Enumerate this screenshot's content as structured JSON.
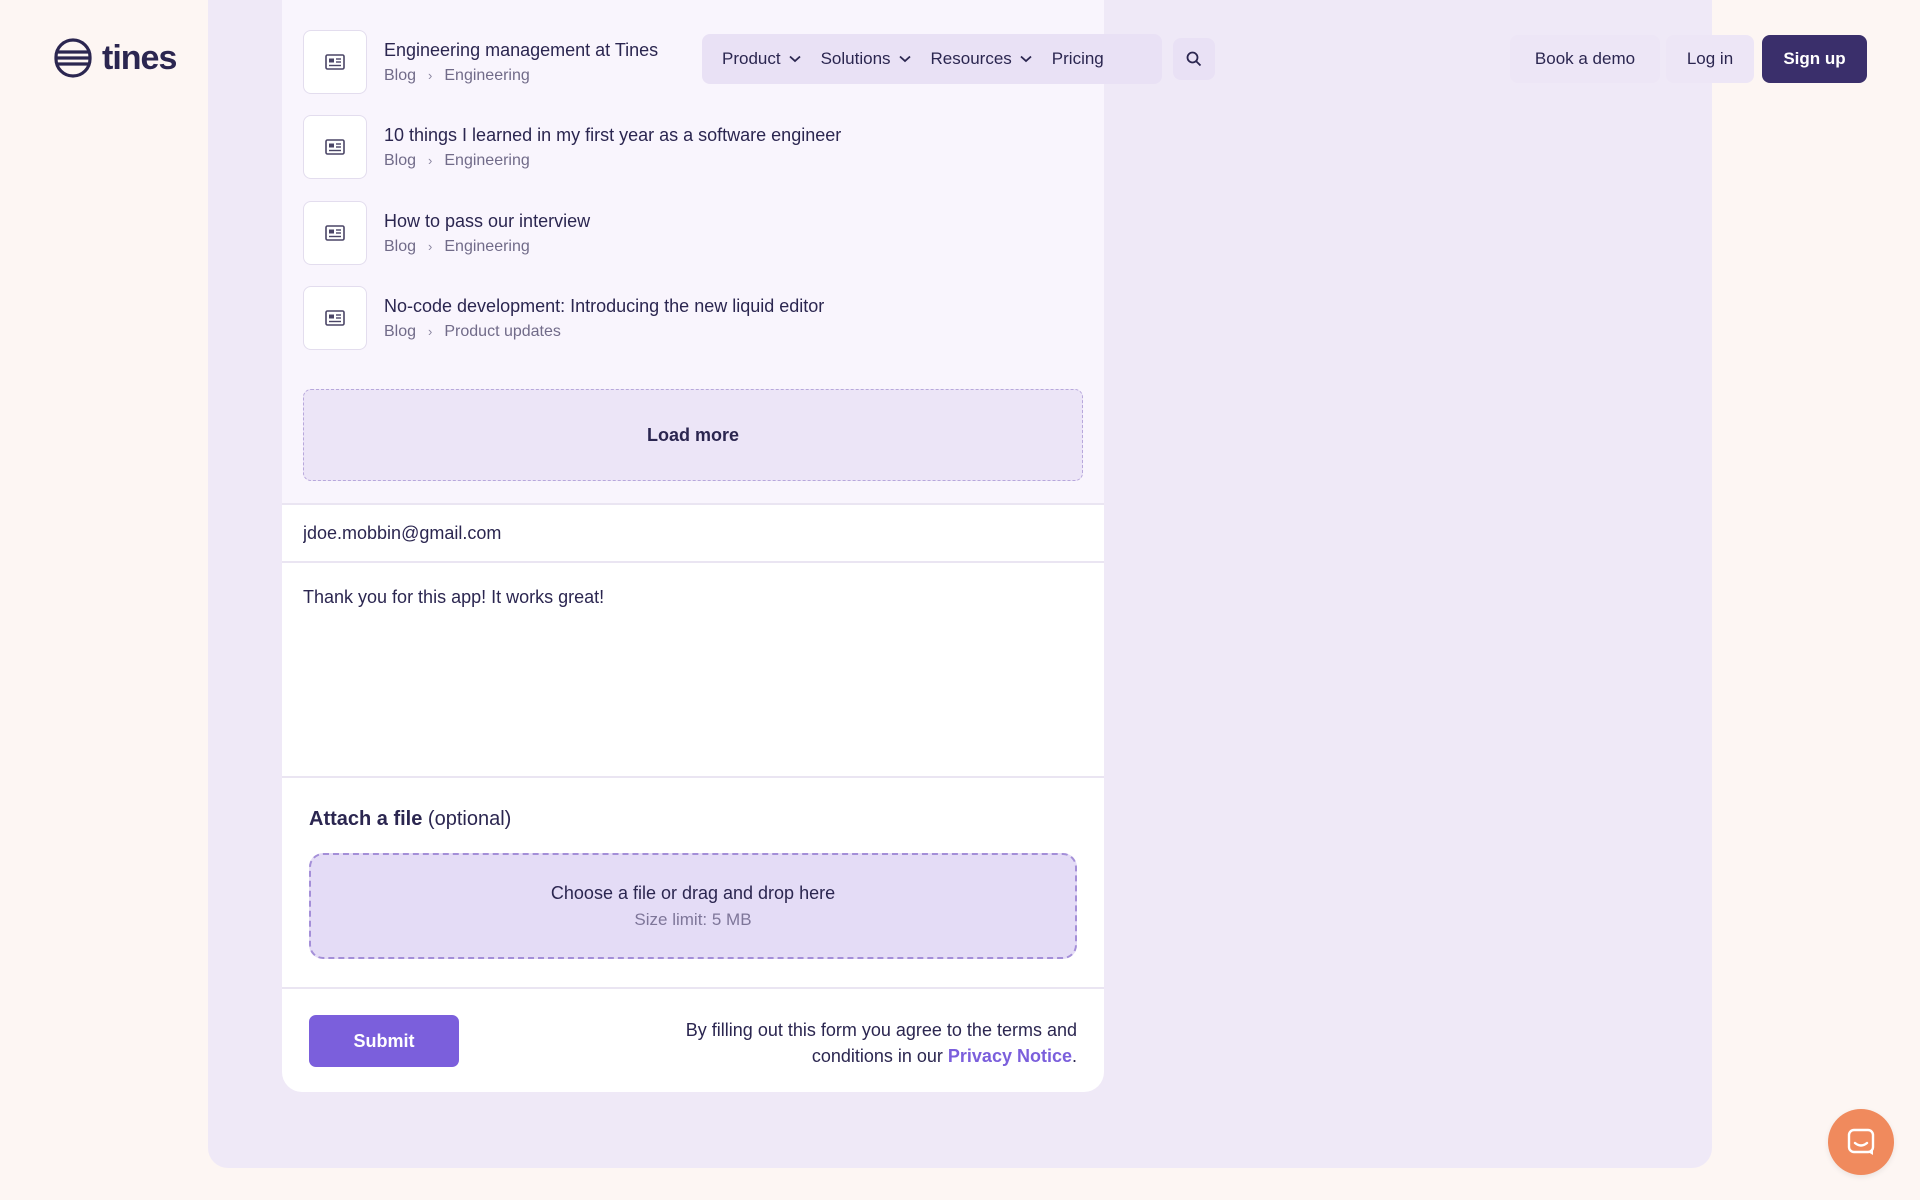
{
  "brand": {
    "name": "tines",
    "logo_icon": "tines-logo-icon"
  },
  "nav": {
    "items": [
      {
        "label": "Product",
        "has_dropdown": true
      },
      {
        "label": "Solutions",
        "has_dropdown": true
      },
      {
        "label": "Resources",
        "has_dropdown": true
      },
      {
        "label": "Pricing",
        "has_dropdown": false
      }
    ],
    "search_icon": "search-icon"
  },
  "header_actions": {
    "book_demo": "Book a demo",
    "log_in": "Log in",
    "sign_up": "Sign up"
  },
  "results": [
    {
      "title": "Engineering management at Tines",
      "crumbs": [
        "Blog",
        "Engineering"
      ]
    },
    {
      "title": "10 things I learned in my first year as a software engineer",
      "crumbs": [
        "Blog",
        "Engineering"
      ]
    },
    {
      "title": "How to pass our interview",
      "crumbs": [
        "Blog",
        "Engineering"
      ]
    },
    {
      "title": "No-code development: Introducing the new liquid editor",
      "crumbs": [
        "Blog",
        "Product updates"
      ]
    }
  ],
  "load_more": "Load more",
  "form": {
    "email_value": "jdoe.mobbin@gmail.com",
    "message_value": "Thank you for this app! It works great!",
    "attach_label_bold": "Attach a file",
    "attach_label_optional": " (optional)",
    "dropzone_main": "Choose a file or drag and drop here",
    "dropzone_sub": "Size limit: 5 MB",
    "submit_label": "Submit",
    "terms_text": "By filling out this form you agree to the terms and conditions in our ",
    "privacy_link": "Privacy Notice",
    "terms_end": "."
  },
  "colors": {
    "accent": "#7b5fdc",
    "dark": "#3a2f6b",
    "chat": "#f08a5d"
  },
  "chat_icon": "chat-icon"
}
